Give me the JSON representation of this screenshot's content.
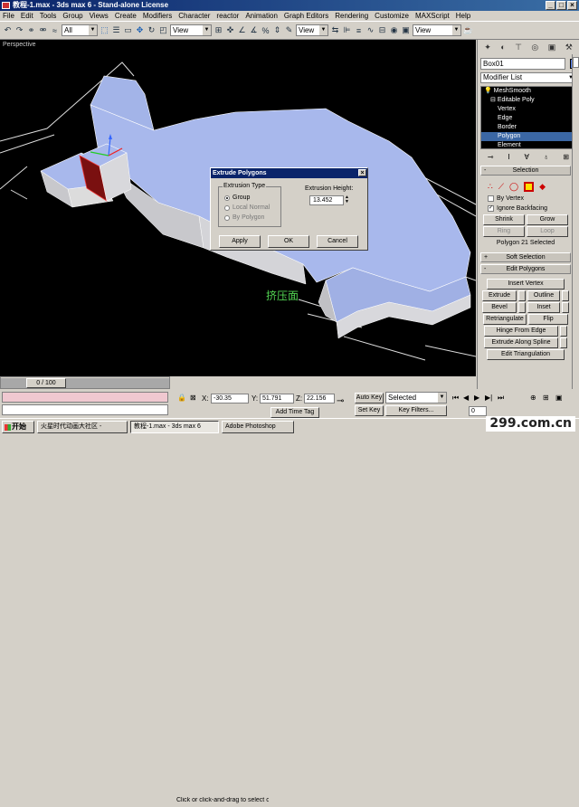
{
  "window": {
    "title": "教程-1.max - 3ds max 6 - Stand-alone License"
  },
  "menu": [
    "File",
    "Edit",
    "Tools",
    "Group",
    "Views",
    "Create",
    "Modifiers",
    "Character",
    "reactor",
    "Animation",
    "Graph Editors",
    "Rendering",
    "Customize",
    "MAXScript",
    "Help"
  ],
  "toolbar": {
    "selection_filter": "All",
    "ref_coord": "View",
    "named_sel": "View"
  },
  "viewport": {
    "label": "Perspective",
    "annotation": "挤压面"
  },
  "dialog": {
    "title": "Extrude Polygons",
    "group_label": "Extrusion Type",
    "options": [
      "Group",
      "Local Normal",
      "By Polygon"
    ],
    "height_label": "Extrusion Height:",
    "height_value": "13.452",
    "apply": "Apply",
    "ok": "OK",
    "cancel": "Cancel"
  },
  "command_panel": {
    "object_name": "Box01",
    "object_color": "#4f7df0",
    "modifier_list": "Modifier List",
    "stack": [
      "MeshSmooth",
      "Editable Poly",
      "Vertex",
      "Edge",
      "Border",
      "Polygon",
      "Element"
    ],
    "selection": {
      "title": "Selection",
      "by_vertex": "By Vertex",
      "ignore_backfacing": "Ignore Backfacing",
      "shrink": "Shrink",
      "grow": "Grow",
      "ring": "Ring",
      "loop": "Loop",
      "info": "Polygon 21 Selected"
    },
    "soft_selection": "Soft Selection",
    "edit_polygons": {
      "title": "Edit Polygons",
      "insert_vertex": "Insert Vertex",
      "extrude": "Extrude",
      "outline": "Outline",
      "bevel": "Bevel",
      "inset": "Inset",
      "retriangulate": "Retriangulate",
      "flip": "Flip",
      "hinge_from_edge": "Hinge From Edge",
      "extrude_along_spline": "Extrude Along Spline",
      "edit_triangulation": "Edit Triangulation"
    }
  },
  "timeline": {
    "frame": "0 / 100"
  },
  "status": {
    "x_label": "X:",
    "x": "-30.35",
    "y_label": "Y:",
    "y": "51.791",
    "z_label": "Z:",
    "z": "22.156",
    "auto_key": "Auto Key",
    "selected": "Selected",
    "set_key": "Set Key",
    "key_filters": "Key Filters...",
    "prompt": "Click or click-and-drag to select obj",
    "add_time_tag": "Add Time Tag",
    "frame_field": "0"
  },
  "taskbar": {
    "start": "开始",
    "tasks": [
      "火星时代动画大社区 -",
      "教程-1.max - 3ds max 6",
      "Adobe Photoshop"
    ]
  },
  "watermark": "299.com.cn"
}
